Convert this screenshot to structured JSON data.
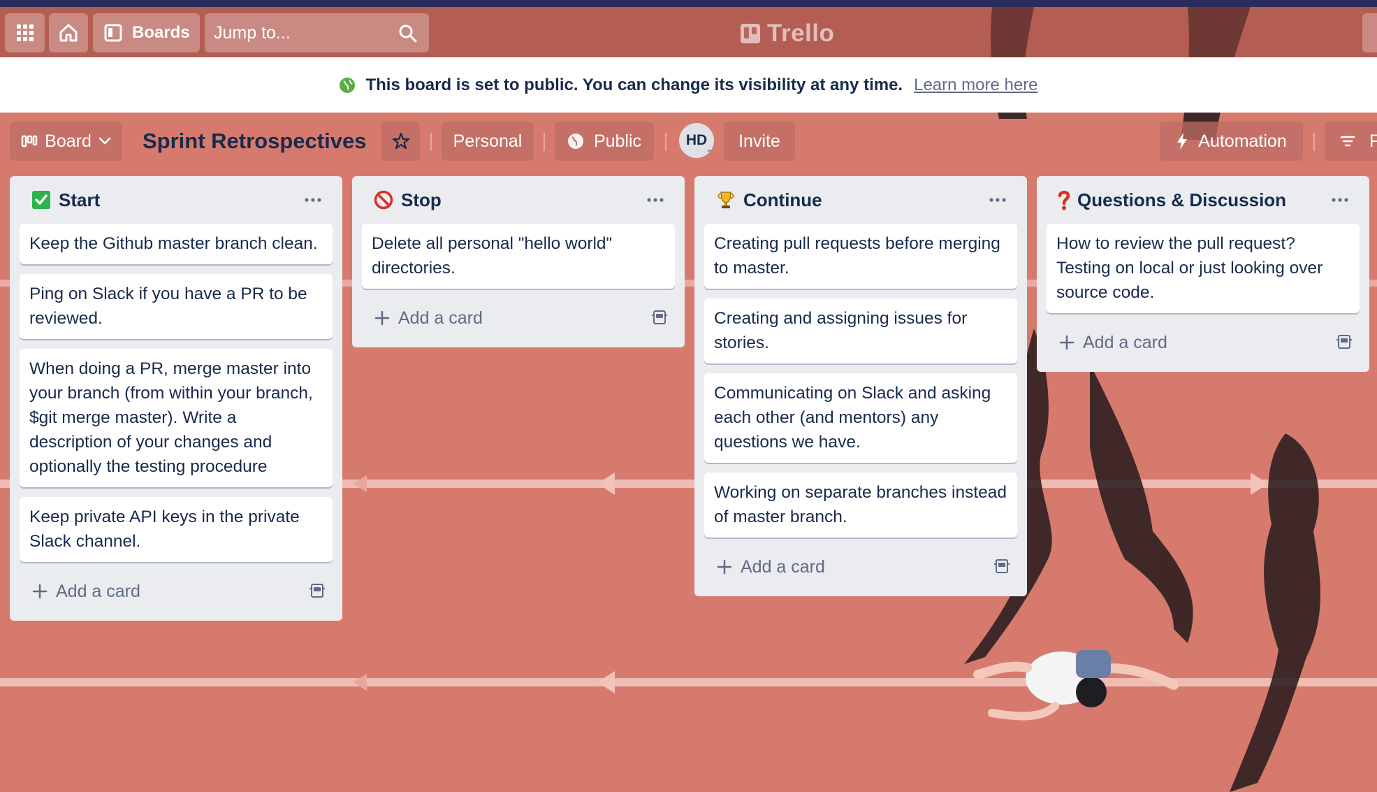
{
  "colors": {
    "brand_bar": "#2a2c5e",
    "track": "#d77a6e",
    "list_bg": "#ebecf0",
    "text_dark": "#172b4d",
    "text_muted": "#5e6c84",
    "public_green": "#5aac44"
  },
  "header": {
    "apps_icon": "grid-icon",
    "home_icon": "home-icon",
    "boards_label": "Boards",
    "search_placeholder": "Jump to...",
    "logo_text": "Trello"
  },
  "banner": {
    "icon": "globe-icon",
    "message": "This board is set to public. You can change its visibility at any time.",
    "link": "Learn more here"
  },
  "board_bar": {
    "view_label": "Board",
    "title": "Sprint Retrospectives",
    "workspace_label": "Personal",
    "visibility_label": "Public",
    "avatar_initials": "HD",
    "invite_label": "Invite",
    "automation_label": "Automation",
    "filter_label": "F"
  },
  "lists": [
    {
      "emoji": "check-mark-emoji",
      "title": "Start",
      "cards": [
        "Keep the Github master branch clean.",
        "Ping on Slack if you have a PR to be reviewed.",
        "When doing a PR, merge master into your branch (from within your branch, $git merge master). Write a description of your changes and optionally the testing procedure",
        "Keep private API keys in the private Slack channel."
      ],
      "add_label": "Add a card"
    },
    {
      "emoji": "prohibited-emoji",
      "title": "Stop",
      "cards": [
        "Delete all personal \"hello world\" directories."
      ],
      "add_label": "Add a card"
    },
    {
      "emoji": "trophy-emoji",
      "title": "Continue",
      "cards": [
        "Creating pull requests before merging to master.",
        "Creating and assigning issues for stories.",
        "Communicating on Slack and asking each other (and mentors) any questions we have.",
        "Working on separate branches instead of master branch."
      ],
      "add_label": "Add a card"
    },
    {
      "emoji": "question-mark-emoji",
      "title": "Questions & Discussion",
      "cards": [
        "How to review the pull request? Testing on local or just looking over source code."
      ],
      "add_label": "Add a card"
    }
  ]
}
